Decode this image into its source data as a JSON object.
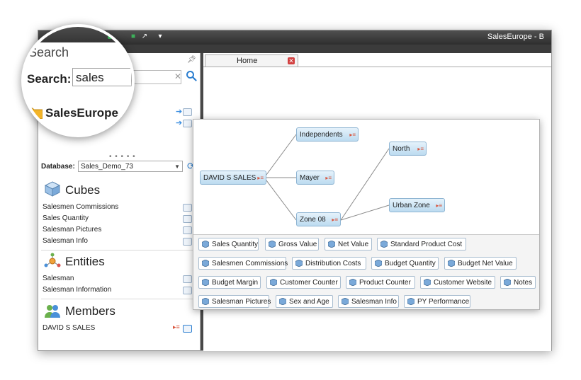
{
  "titlebar": {
    "title": "SalesEurope - B"
  },
  "search": {
    "title": "Search",
    "label": "Search:",
    "value": "sales"
  },
  "cube_header": {
    "name": "SalesEurope"
  },
  "database": {
    "label": "Database:",
    "value": "Sales_Demo_73"
  },
  "sections": {
    "cubes": {
      "title": "Cubes",
      "items": [
        "Salesmen Commissions",
        "Sales Quantity",
        "Salesman Pictures",
        "Salesman Info"
      ]
    },
    "entities": {
      "title": "Entities",
      "items": [
        "Salesman",
        "Salesman Information"
      ]
    },
    "members": {
      "title": "Members",
      "items": [
        "DAVID S SALES"
      ]
    }
  },
  "document": {
    "tab_label": "Home"
  },
  "tree": {
    "root": "DAVID S SALES",
    "level1": [
      "Independents",
      "Mayer",
      "Zone 08"
    ],
    "level2": [
      "North",
      "Urban Zone"
    ]
  },
  "cube_chips": [
    [
      "Sales Quantity",
      "Gross Value",
      "Net Value",
      "Standard Product Cost"
    ],
    [
      "Salesmen Commissions",
      "Distribution Costs",
      "Budget Quantity",
      "Budget Net Value"
    ],
    [
      "Budget Margin",
      "Customer Counter",
      "Product Counter",
      "Customer Website",
      "Notes"
    ],
    [
      "Salesman Pictures",
      "Sex and Age",
      "Salesman Info",
      "PY Performance"
    ]
  ],
  "icons": [
    "pin-icon",
    "search-icon",
    "clear-icon",
    "refresh-icon",
    "cube-icon",
    "entities-icon",
    "members-icon",
    "comment-icon",
    "arrow-icon",
    "close-icon",
    "folder-icon"
  ],
  "colors": {
    "accent": "#2d7fd0",
    "node_fill": "#cfe6f7",
    "titlebar": "#3a3a3a"
  }
}
